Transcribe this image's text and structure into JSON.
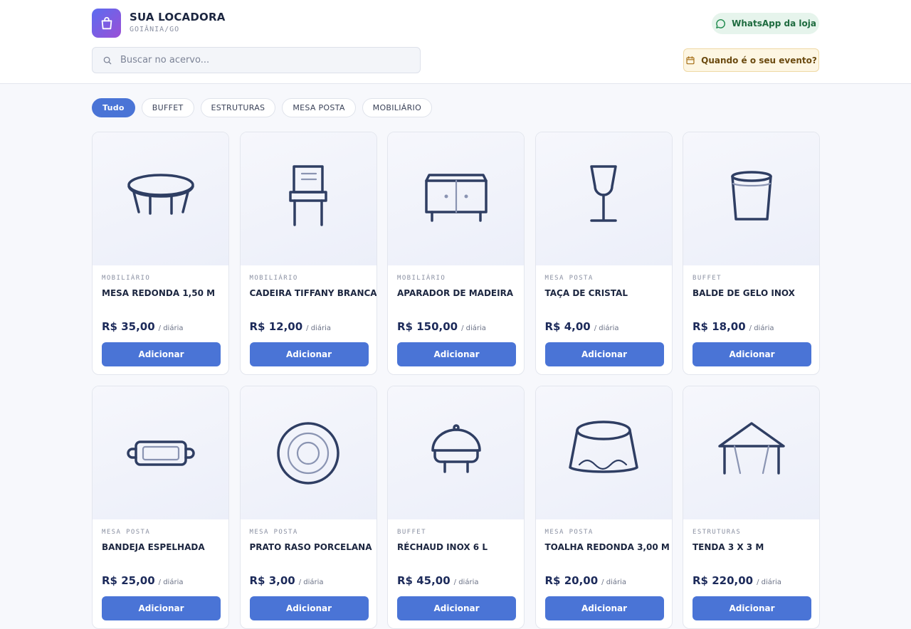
{
  "brand": {
    "name": "SUA LOCADORA",
    "location": "GOIÂNIA/GO"
  },
  "header": {
    "whatsapp_label": "WhatsApp da loja",
    "search_placeholder": "Buscar no acervo...",
    "event_label": "Quando é o seu evento?"
  },
  "filters": [
    "Tudo",
    "BUFFET",
    "ESTRUTURAS",
    "MESA POSTA",
    "MOBILIÁRIO"
  ],
  "active_filter": "Tudo",
  "price_unit": "/ diária",
  "add_label": "Adicionar",
  "products": [
    {
      "category": "MOBILIÁRIO",
      "name": "MESA REDONDA 1,50 M",
      "price": "R$ 35,00",
      "icon": "round-table-icon"
    },
    {
      "category": "MOBILIÁRIO",
      "name": "CADEIRA TIFFANY BRANCA",
      "price": "R$ 12,00",
      "icon": "chair-icon"
    },
    {
      "category": "MOBILIÁRIO",
      "name": "APARADOR DE MADEIRA",
      "price": "R$ 150,00",
      "icon": "sideboard-icon"
    },
    {
      "category": "MESA POSTA",
      "name": "TAÇA DE CRISTAL",
      "price": "R$ 4,00",
      "icon": "wine-glass-icon"
    },
    {
      "category": "BUFFET",
      "name": "BALDE DE GELO INOX",
      "price": "R$ 18,00",
      "icon": "ice-bucket-icon"
    },
    {
      "category": "MESA POSTA",
      "name": "BANDEJA ESPELHADA",
      "price": "R$ 25,00",
      "icon": "tray-icon"
    },
    {
      "category": "MESA POSTA",
      "name": "PRATO RASO PORCELANA",
      "price": "R$ 3,00",
      "icon": "plate-icon"
    },
    {
      "category": "BUFFET",
      "name": "RÉCHAUD INOX 6 L",
      "price": "R$ 45,00",
      "icon": "chafing-dish-icon"
    },
    {
      "category": "MESA POSTA",
      "name": "TOALHA REDONDA 3,00 M",
      "price": "R$ 20,00",
      "icon": "tablecloth-icon"
    },
    {
      "category": "ESTRUTURAS",
      "name": "TENDA 3 X 3 M",
      "price": "R$ 220,00",
      "icon": "tent-icon"
    }
  ],
  "colors": {
    "accent": "#4a74d6",
    "navy": "#1c2640",
    "icon_stroke": "#2f3e63"
  }
}
